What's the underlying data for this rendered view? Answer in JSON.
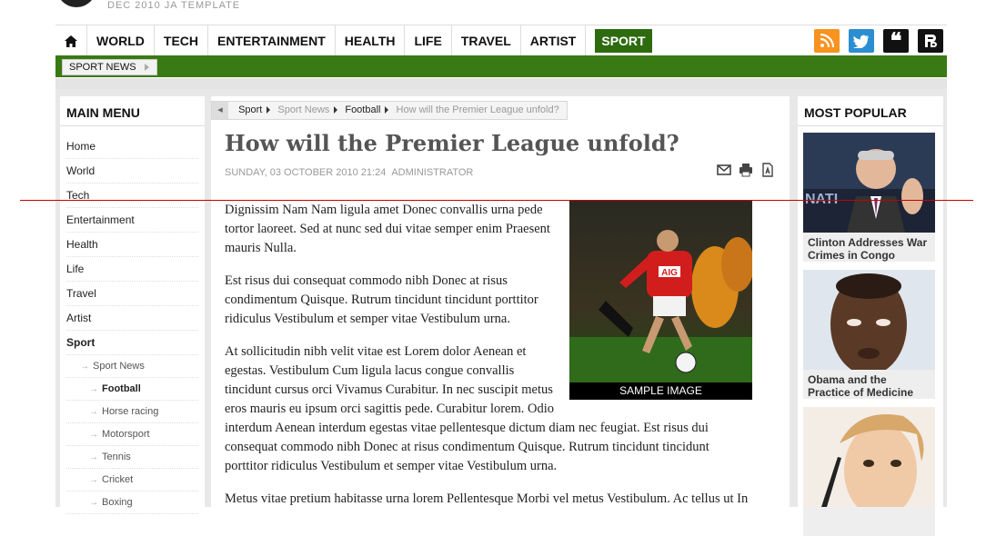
{
  "site": {
    "subtitle": "DEC 2010 JA TEMPLATE"
  },
  "nav": {
    "items": [
      "WORLD",
      "TECH",
      "ENTERTAINMENT",
      "HEALTH",
      "LIFE",
      "TRAVEL",
      "ARTIST"
    ],
    "active": "SPORT",
    "icons": [
      "home-icon",
      "rss-icon",
      "twitter-icon",
      "quote-icon",
      "bookmark-icon"
    ],
    "quote_glyph": "❝",
    "colors": {
      "accent": "#2e6b0f",
      "rss": "#f7931e",
      "twitter": "#2a8ed2"
    }
  },
  "subnav": {
    "item": "SPORT NEWS"
  },
  "left_menu": {
    "title": "MAIN MENU",
    "items": [
      "Home",
      "World",
      "Tech",
      "Entertainment",
      "Health",
      "Life",
      "Travel",
      "Artist",
      "Sport"
    ],
    "sub": "Sport News",
    "sub_items": [
      "Football",
      "Horse racing",
      "Motorsport",
      "Tennis",
      "Cricket",
      "Boxing"
    ]
  },
  "article": {
    "breadcrumb": [
      "Sport",
      "Sport News",
      "Football",
      "How will the Premier League unfold?"
    ],
    "title": "How will the Premier League unfold?",
    "date": "SUNDAY, 03 OCTOBER 2010 21:24",
    "author": "ADMINISTRATOR",
    "image_caption": "SAMPLE IMAGE",
    "image_sponsor": "AIG",
    "paragraphs": [
      "Dignissim Nam Nam ligula amet Donec convallis urna pede tortor laoreet. Sed at nunc sed dui vitae semper enim Praesent mauris Nulla.",
      "Est risus dui consequat commodo nibh Donec at risus condimentum Quisque. Rutrum tincidunt tincidunt porttitor ridiculus Vestibulum et semper vitae Vestibulum urna.",
      "At sollicitudin nibh velit vitae est Lorem dolor Aenean et egestas. Vestibulum Cum ligula lacus congue convallis tincidunt cursus orci Vivamus Curabitur. In nec suscipit metus eros mauris eu ipsum orci sagittis pede. Curabitur lorem. Odio interdum Aenean interdum egestas vitae pellentesque dictum diam nec feugiat. Est risus dui consequat commodo nibh Donec at risus condimentum Quisque. Rutrum tincidunt tincidunt porttitor ridiculus Vestibulum et semper vitae Vestibulum urna.",
      "Metus vitae pretium habitasse urna lorem Pellentesque Morbi vel metus Vestibulum. Ac tellus ut In"
    ]
  },
  "most_popular": {
    "title": "MOST POPULAR",
    "items": [
      {
        "caption": "Clinton Addresses War Crimes in Congo",
        "thumb_text": "NATI"
      },
      {
        "caption": "Obama and the Practice of Medicine"
      },
      {
        "caption": ""
      }
    ]
  }
}
